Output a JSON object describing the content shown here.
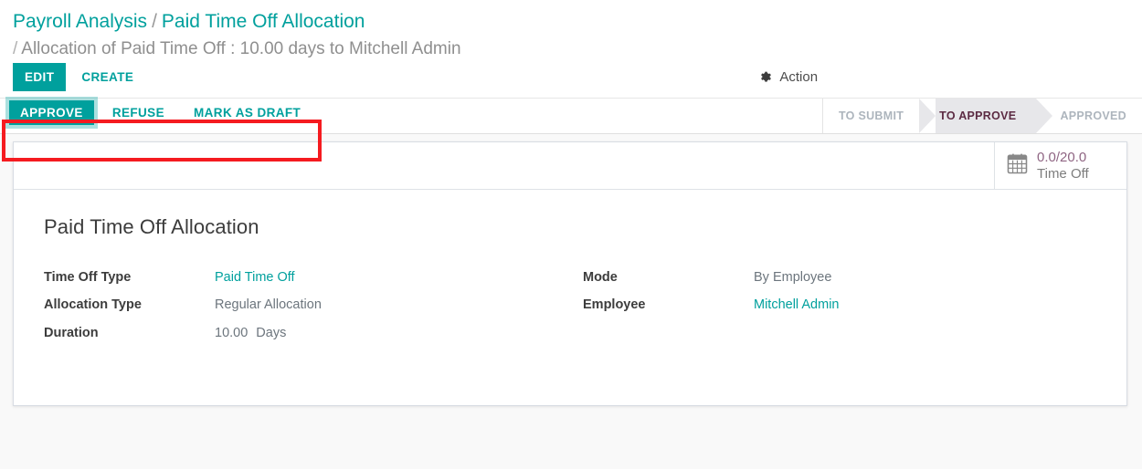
{
  "breadcrumb": {
    "root": "Payroll Analysis",
    "separator": "/",
    "current": "Paid Time Off Allocation",
    "record_separator": "/",
    "record": "Allocation of Paid Time Off : 10.00 days to Mitchell Admin"
  },
  "control_panel": {
    "edit_label": "EDIT",
    "create_label": "CREATE",
    "action_label": "Action",
    "action_icon": "gear-icon"
  },
  "workflow_buttons": [
    {
      "label": "APPROVE",
      "style": "primary"
    },
    {
      "label": "REFUSE",
      "style": "flat"
    },
    {
      "label": "MARK AS DRAFT",
      "style": "flat"
    }
  ],
  "statusbar": {
    "stages": [
      {
        "label": "TO SUBMIT",
        "active": false
      },
      {
        "label": "TO APPROVE",
        "active": true
      },
      {
        "label": "APPROVED",
        "active": false
      }
    ]
  },
  "smart_button": {
    "icon": "calendar-icon",
    "value": "0.0/20.0",
    "label": "Time Off"
  },
  "form": {
    "title": "Paid Time Off Allocation",
    "left_fields": [
      {
        "label": "Time Off Type",
        "value": "Paid Time Off",
        "is_link": true,
        "unit": ""
      },
      {
        "label": "Allocation Type",
        "value": "Regular Allocation",
        "is_link": false,
        "unit": ""
      },
      {
        "label": "Duration",
        "value": "10.00",
        "is_link": false,
        "unit": "Days"
      }
    ],
    "right_fields": [
      {
        "label": "Mode",
        "value": "By Employee",
        "is_link": false,
        "unit": ""
      },
      {
        "label": "Employee",
        "value": "Mitchell Admin",
        "is_link": true,
        "unit": ""
      }
    ]
  },
  "colors": {
    "accent": "#00a09d",
    "highlight_box": "#f51b20",
    "status_active_text": "#5c2b43",
    "status_inactive_text": "#adb5bd",
    "smart_value": "#8f6583"
  }
}
